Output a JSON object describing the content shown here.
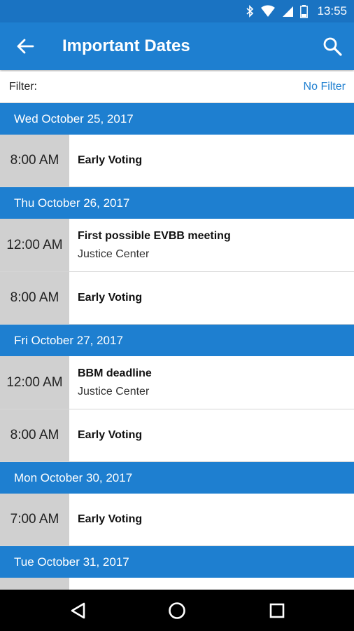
{
  "status_bar": {
    "time": "13:55",
    "icons": [
      "bluetooth-icon",
      "wifi-icon",
      "signal-icon",
      "battery-icon"
    ]
  },
  "app_bar": {
    "title": "Important Dates",
    "back_icon": "arrow-left-icon",
    "search_icon": "search-icon"
  },
  "filter": {
    "label": "Filter:",
    "value": "No Filter"
  },
  "days": [
    {
      "date": "Wed October 25, 2017",
      "events": [
        {
          "time": "8:00 AM",
          "title": "Early Voting",
          "location": ""
        }
      ]
    },
    {
      "date": "Thu October 26, 2017",
      "events": [
        {
          "time": "12:00 AM",
          "title": "First possible EVBB meeting",
          "location": "Justice Center"
        },
        {
          "time": "8:00 AM",
          "title": "Early Voting",
          "location": ""
        }
      ]
    },
    {
      "date": "Fri October 27, 2017",
      "events": [
        {
          "time": "12:00 AM",
          "title": "BBM deadline",
          "location": "Justice Center"
        },
        {
          "time": "8:00 AM",
          "title": "Early Voting",
          "location": ""
        }
      ]
    },
    {
      "date": "Mon October 30, 2017",
      "events": [
        {
          "time": "7:00 AM",
          "title": "Early Voting",
          "location": ""
        }
      ]
    },
    {
      "date": "Tue October 31, 2017",
      "events": [
        {
          "time": "",
          "title": "",
          "location": ""
        }
      ]
    }
  ],
  "nav_bar": {
    "buttons": [
      "back-triangle-icon",
      "home-circle-icon",
      "recents-square-icon"
    ]
  },
  "colors": {
    "status_bar": "#1a73c2",
    "primary": "#1e7fd0",
    "time_cell": "#d0d0d0",
    "nav_bar": "#000000"
  }
}
